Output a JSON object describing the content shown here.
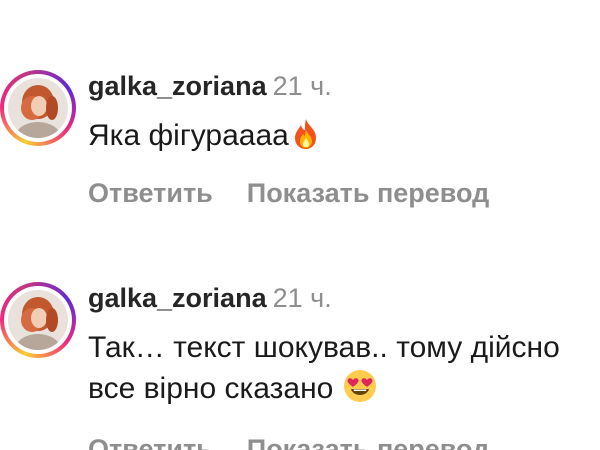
{
  "comments": [
    {
      "username": "galka_zoriana",
      "time": "21 ч.",
      "text": "Яка фігураааа",
      "emoji_icon": "fire-icon",
      "reply_label": "Ответить",
      "translate_label": "Показать перевод"
    },
    {
      "username": "galka_zoriana",
      "time": "21 ч.",
      "text": "Так… текст шокував.. тому дійсно все вірно сказано",
      "emoji_icon": "heart-eyes-emoji-icon",
      "reply_label": "Ответить",
      "translate_label": "Показать перевод"
    }
  ],
  "colors": {
    "username": "#262626",
    "muted": "#8e8e8e",
    "text": "#1a1a1a",
    "story_ring": [
      "#f9ce34",
      "#ee2a7b",
      "#6228d7"
    ]
  }
}
